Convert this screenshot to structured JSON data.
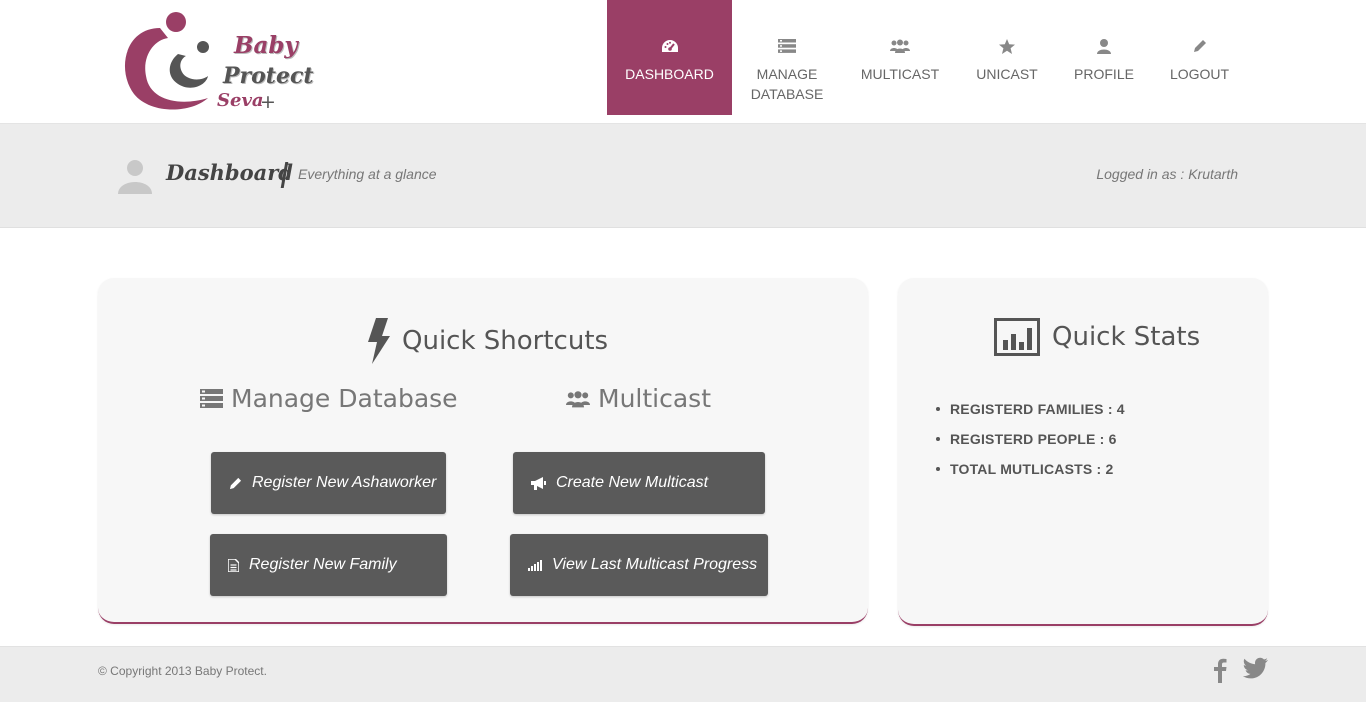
{
  "brand": {
    "line1": "Baby",
    "line2": "Protect",
    "line3": "Seva",
    "plus": "+",
    "colors": {
      "primary": "#9a3f66",
      "dark": "#555555"
    }
  },
  "nav": {
    "items": [
      {
        "label": "DASHBOARD",
        "icon": "dashboard-icon",
        "active": true
      },
      {
        "label": "MANAGE\nDATABASE",
        "icon": "database-icon"
      },
      {
        "label": "MULTICAST",
        "icon": "group-icon"
      },
      {
        "label": "UNICAST",
        "icon": "star-icon"
      },
      {
        "label": "PROFILE",
        "icon": "user-icon"
      },
      {
        "label": "LOGOUT",
        "icon": "pencil-icon"
      }
    ]
  },
  "header_band": {
    "title": "Dashboard",
    "subtitle": "Everything at a glance",
    "logged_in": "Logged in as : Krutarth"
  },
  "shortcuts": {
    "heading": "Quick Shortcuts",
    "database_heading": "Manage Database",
    "multicast_heading": "Multicast",
    "buttons": {
      "register_ashaworker": "Register New Ashaworker",
      "create_multicast": "Create New Multicast",
      "register_family": "Register New Family",
      "view_progress": "View Last Multicast Progress"
    }
  },
  "stats": {
    "heading": "Quick Stats",
    "items": [
      "REGISTERD FAMILIES : 4",
      "REGISTERD PEOPLE : 6",
      "TOTAL MUTLICASTS : 2"
    ]
  },
  "footer": {
    "copyright": "© Copyright 2013 Baby Protect.",
    "social": [
      "facebook-icon",
      "twitter-icon"
    ]
  }
}
